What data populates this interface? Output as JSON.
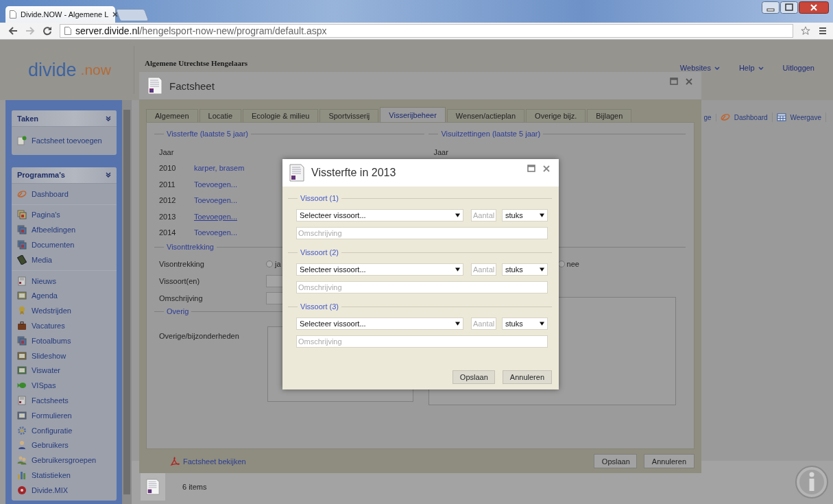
{
  "browser": {
    "tab_title": "Divide.NOW - Algemene L",
    "url_domain": "server.divide.nl",
    "url_path": "/hengelsport-now-new/program/default.aspx"
  },
  "app": {
    "logo": {
      "word": "divide",
      "suffix": ".now"
    },
    "organization": "Algemene Utrechtse Hengelaars",
    "top_nav": [
      {
        "label": "Websites",
        "dropdown": true
      },
      {
        "label": "Help",
        "dropdown": true
      },
      {
        "label": "Uitloggen",
        "dropdown": false
      }
    ],
    "toolbar": [
      {
        "label": "ge",
        "kind": "plain"
      },
      {
        "label": "Dashboard",
        "kind": "swirl"
      },
      {
        "label": "Weergave",
        "kind": "grid"
      }
    ],
    "sidebar": [
      {
        "title": "Taken",
        "groups": [
          [
            {
              "label": "Factsheet toevoegen",
              "kind": "add-page"
            }
          ]
        ]
      },
      {
        "title": "Programma's",
        "groups": [
          [
            {
              "label": "Dashboard",
              "kind": "dashboard"
            }
          ],
          [
            {
              "label": "Pagina's",
              "kind": "pages"
            },
            {
              "label": "Afbeeldingen",
              "kind": "images"
            },
            {
              "label": "Documenten",
              "kind": "documents"
            },
            {
              "label": "Media",
              "kind": "media"
            }
          ],
          [
            {
              "label": "Nieuws",
              "kind": "news"
            },
            {
              "label": "Agenda",
              "kind": "calendar"
            },
            {
              "label": "Wedstrijden",
              "kind": "award"
            },
            {
              "label": "Vacatures",
              "kind": "briefcase"
            },
            {
              "label": "Fotoalbums",
              "kind": "photos"
            },
            {
              "label": "Slideshow",
              "kind": "slideshow"
            },
            {
              "label": "Viswater",
              "kind": "water"
            },
            {
              "label": "VISpas",
              "kind": "fish"
            },
            {
              "label": "Factsheets",
              "kind": "factsheet"
            },
            {
              "label": "Formulieren",
              "kind": "form"
            },
            {
              "label": "Configuratie",
              "kind": "gear"
            },
            {
              "label": "Gebruikers",
              "kind": "user"
            },
            {
              "label": "Gebruikersgroepen",
              "kind": "users"
            },
            {
              "label": "Statistieken",
              "kind": "chart"
            },
            {
              "label": "Divide.MIX",
              "kind": "mix"
            }
          ]
        ]
      }
    ],
    "status": {
      "count": "6 items"
    }
  },
  "factsheet": {
    "title": "Factsheet",
    "tabs": [
      {
        "label": "Algemeen",
        "selected": false
      },
      {
        "label": "Locatie",
        "selected": false
      },
      {
        "label": "Ecologie & milieu",
        "selected": false
      },
      {
        "label": "Sportvisserij",
        "selected": false
      },
      {
        "label": "Visserijbeheer",
        "selected": true
      },
      {
        "label": "Wensen/actieplan",
        "selected": false
      },
      {
        "label": "Overige bijz.",
        "selected": false
      },
      {
        "label": "Bijlagen",
        "selected": false
      }
    ],
    "vissterfte": {
      "legend": "Vissterfte (laatste 5 jaar)",
      "header": "Jaar",
      "rows": [
        {
          "year": "2010",
          "value": "karper, brasem",
          "focused": false
        },
        {
          "year": "2011",
          "value": "Toevoegen...",
          "focused": false
        },
        {
          "year": "2012",
          "value": "Toevoegen...",
          "focused": false
        },
        {
          "year": "2013",
          "value": "Toevoegen...",
          "focused": true
        },
        {
          "year": "2014",
          "value": "Toevoegen...",
          "focused": false
        }
      ]
    },
    "visuitzettingen": {
      "legend": "Visuitzettingen (laatste 5 jaar)",
      "header": "Jaar"
    },
    "visonttrekking": {
      "legend": "Visonttrekking",
      "radio_label": "Visontrekking",
      "options": [
        {
          "label": "ja",
          "checked": false
        },
        {
          "label": "nee",
          "checked": false
        }
      ],
      "input_labels": [
        "Vissoort(en)",
        "Omschrijving"
      ]
    },
    "overig": {
      "legend": "Overig",
      "label": "Overige/bijzonderheden"
    },
    "footer": {
      "link": "Factsheet bekijken",
      "buttons": [
        "Opslaan",
        "Annuleren"
      ]
    }
  },
  "dialog": {
    "title": "Vissterfte in 2013",
    "sections": [
      {
        "legend": "Vissoort (1)",
        "species": "Selecteer vissoort...",
        "amount_placeholder": "Aantal",
        "unit": "stuks",
        "description_placeholder": "Omschrijving"
      },
      {
        "legend": "Vissoort (2)",
        "species": "Selecteer vissoort...",
        "amount_placeholder": "Aantal",
        "unit": "stuks",
        "description_placeholder": "Omschrijving"
      },
      {
        "legend": "Vissoort (3)",
        "species": "Selecteer vissoort...",
        "amount_placeholder": "Aantal",
        "unit": "stuks",
        "description_placeholder": "Omschrijving"
      }
    ],
    "buttons": [
      "Opslaan",
      "Annuleren"
    ]
  }
}
